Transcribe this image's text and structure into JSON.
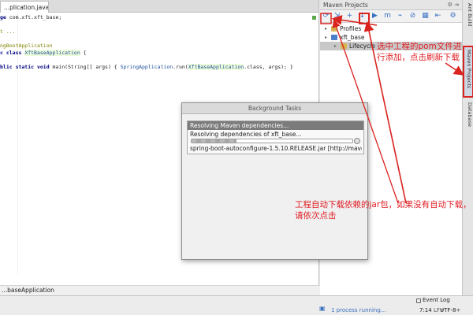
{
  "editor": {
    "tab_label": "...plication.java",
    "tab_close": "×",
    "code_lines": [
      {
        "segments": [
          {
            "t": "ge ",
            "c": "kw"
          },
          {
            "t": "com.xft.xft_base;",
            "c": ""
          }
        ]
      },
      {
        "segments": [
          {
            "t": "",
            "c": ""
          }
        ]
      },
      {
        "segments": [
          {
            "t": "t ...",
            "c": "ann"
          }
        ]
      },
      {
        "segments": [
          {
            "t": "",
            "c": ""
          }
        ]
      },
      {
        "segments": [
          {
            "t": "ngBootApplication",
            "c": "ann"
          }
        ]
      },
      {
        "segments": [
          {
            "t": "c ",
            "c": "kw"
          },
          {
            "t": "class ",
            "c": "kw"
          },
          {
            "t": "XftBaseApplication",
            "c": "hl"
          },
          {
            "t": " {",
            "c": ""
          }
        ]
      },
      {
        "segments": [
          {
            "t": "",
            "c": ""
          }
        ]
      },
      {
        "segments": [
          {
            "t": "blic static void ",
            "c": "kw"
          },
          {
            "t": "main(String[] args) { ",
            "c": ""
          },
          {
            "t": "SpringApplication",
            "c": "sp"
          },
          {
            "t": ".run(",
            "c": ""
          },
          {
            "t": "XftBaseApplication",
            "c": "hl"
          },
          {
            "t": ".class, args); }",
            "c": ""
          }
        ]
      },
      {
        "segments": [
          {
            "t": "",
            "c": ""
          }
        ]
      },
      {
        "segments": [
          {
            "t": "",
            "c": ""
          }
        ]
      }
    ],
    "breadcrumb": "...baseApplication"
  },
  "maven_panel": {
    "title": "Maven Projects",
    "header_controls": "⚙ ⇥",
    "toolbar_icons": [
      {
        "name": "reimport-icon",
        "glyph": "⟳"
      },
      {
        "name": "generate-sources-icon",
        "glyph": "⇲"
      },
      {
        "name": "add-maven-project-icon",
        "glyph": "+"
      },
      {
        "name": "download-sources-icon",
        "glyph": "↓"
      },
      {
        "name": "run-icon",
        "glyph": "▶"
      },
      {
        "name": "execute-goal-icon",
        "glyph": "m"
      },
      {
        "name": "toggle-offline-icon",
        "glyph": "⌁"
      },
      {
        "name": "skip-tests-icon",
        "glyph": "⊘"
      },
      {
        "name": "show-dependencies-icon",
        "glyph": "▦"
      },
      {
        "name": "collapse-all-icon",
        "glyph": "⇤"
      },
      {
        "name": "settings-icon",
        "glyph": "⚙"
      }
    ],
    "tree": [
      {
        "label": "Profiles",
        "depth": 0,
        "icon": "folder"
      },
      {
        "label": "xft_base",
        "depth": 0,
        "icon": "mfolder"
      },
      {
        "label": "Lifecycle",
        "depth": 1,
        "icon": "folder"
      }
    ]
  },
  "right_strip": {
    "tabs": [
      "Ant Build",
      "Maven Projects",
      "Database"
    ]
  },
  "background_tasks": {
    "title": "Background Tasks",
    "task_header": "Resolving Maven dependencies...",
    "task_sub": "Resolving dependencies of xft_base...",
    "file_text": "spring-boot-autoconfigure-1.5.10.RELEASE.jar [http://maven...",
    "progress": 0.28
  },
  "statusbar": {
    "event_log": "Event Log",
    "process_text": "1 process running...",
    "position": "7:14",
    "separator": "LF÷",
    "encoding": "UTF-8÷"
  },
  "annotations": {
    "note1": "选中工程的pom文件进行添加，点击刷新下载",
    "note2": "工程自动下载依赖的jar包，如果没有自动下载，请依次点击",
    "color": "#e01f25"
  }
}
